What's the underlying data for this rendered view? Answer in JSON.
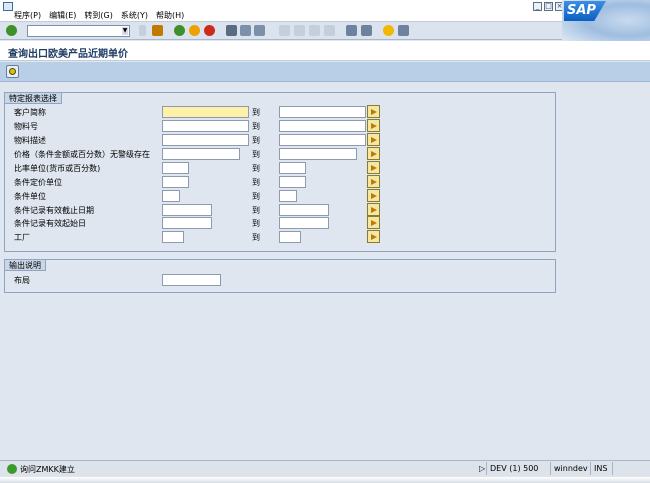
{
  "menu": [
    "程序(P)",
    "编辑(E)",
    "转到(G)",
    "系统(Y)",
    "帮助(H)"
  ],
  "logo": "SAP",
  "title": "查询出口欧美产品近期单价",
  "selection": {
    "legend": "特定报表选择",
    "to_label": "到",
    "rows": [
      {
        "label": "客户简称"
      },
      {
        "label": "物料号"
      },
      {
        "label": "物料描述"
      },
      {
        "label": "价格（条件金额或百分数）无警级存在"
      },
      {
        "label": "比率单位(货币或百分数)"
      },
      {
        "label": "条件定价单位"
      },
      {
        "label": "条件单位"
      },
      {
        "label": "条件记录有效截止日期"
      },
      {
        "label": "条件记录有效起始日"
      },
      {
        "label": "工厂"
      }
    ]
  },
  "output": {
    "legend": "输出说明",
    "layout_label": "布局"
  },
  "status": {
    "message": "询问ZMKK建立",
    "system": "DEV (1) 500",
    "server": "winndev",
    "mode": "INS"
  },
  "colors": {
    "focus_field": "#fff0a8",
    "app_toolbar": "#b9cfe8",
    "group_bg": "#dfe6ef"
  }
}
